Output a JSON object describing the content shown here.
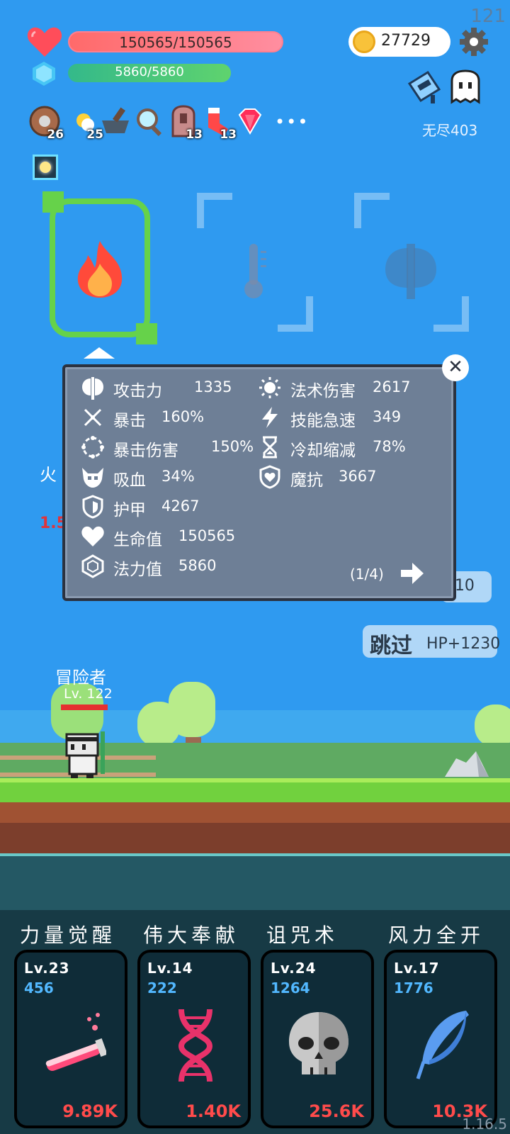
{
  "fps": "121",
  "version": "1.16.5",
  "player": {
    "hp_text": "150565/150565",
    "mp_text": "5860/5860"
  },
  "currency": {
    "coins": "27729"
  },
  "endless": "无尽403",
  "items": [
    {
      "icon": "shield-icon",
      "count": "26"
    },
    {
      "icon": "sun-icon",
      "count": "25"
    },
    {
      "icon": "mortar-icon",
      "count": ""
    },
    {
      "icon": "magnifier-icon",
      "count": ""
    },
    {
      "icon": "door-icon",
      "count": "13"
    },
    {
      "icon": "sock-icon",
      "count": "13"
    },
    {
      "icon": "ruby-icon",
      "count": ""
    }
  ],
  "more_label": "•••",
  "stats_left": [
    {
      "label": "攻击力",
      "value": "1335",
      "icon": "axe-stat-icon"
    },
    {
      "label": "暴击",
      "value": "160%",
      "icon": "crit-icon"
    },
    {
      "label": "暴击伤害",
      "value": "150%",
      "icon": "crit-damage-icon"
    },
    {
      "label": "吸血",
      "value": "34%",
      "icon": "lifesteal-icon"
    },
    {
      "label": "护甲",
      "value": "4267",
      "icon": "armor-icon"
    },
    {
      "label": "生命值",
      "value": "150565",
      "icon": "heart-stat-icon"
    },
    {
      "label": "法力值",
      "value": "5860",
      "icon": "mana-stat-icon"
    }
  ],
  "stats_right": [
    {
      "label": "法术伤害",
      "value": "2617",
      "icon": "spell-damage-icon"
    },
    {
      "label": "技能急速",
      "value": "349",
      "icon": "haste-icon"
    },
    {
      "label": "冷却缩减",
      "value": "78%",
      "icon": "hourglass-icon"
    },
    {
      "label": "魔抗",
      "value": "3667",
      "icon": "magic-resist-icon"
    }
  ],
  "pager": "(1/4)",
  "side_label_1": "火",
  "side_label_2": "1.5",
  "level_pill": "-10",
  "skip": {
    "label": "跳过",
    "hp": "HP+1230"
  },
  "hero": {
    "name": "冒险者",
    "level": "Lv. 122"
  },
  "skills": [
    {
      "title": "力量觉醒",
      "level": "Lv.23",
      "value": "456",
      "cost": "9.89K",
      "icon": "potion-icon"
    },
    {
      "title": "伟大奉献",
      "level": "Lv.14",
      "value": "222",
      "cost": "1.40K",
      "icon": "dna-icon"
    },
    {
      "title": "诅咒术",
      "level": "Lv.24",
      "value": "1264",
      "cost": "25.6K",
      "icon": "skull-icon"
    },
    {
      "title": "风力全开",
      "level": "Lv.17",
      "value": "1776",
      "cost": "10.3K",
      "icon": "feather-icon"
    }
  ],
  "colors": {
    "sky": "#2f9af0",
    "hp": "#ff7f90",
    "mp": "#5fd36e",
    "panel": "#6e7f96",
    "selected": "#66d24a",
    "cost": "#ff4b4b",
    "skill_value": "#52b8ff"
  }
}
